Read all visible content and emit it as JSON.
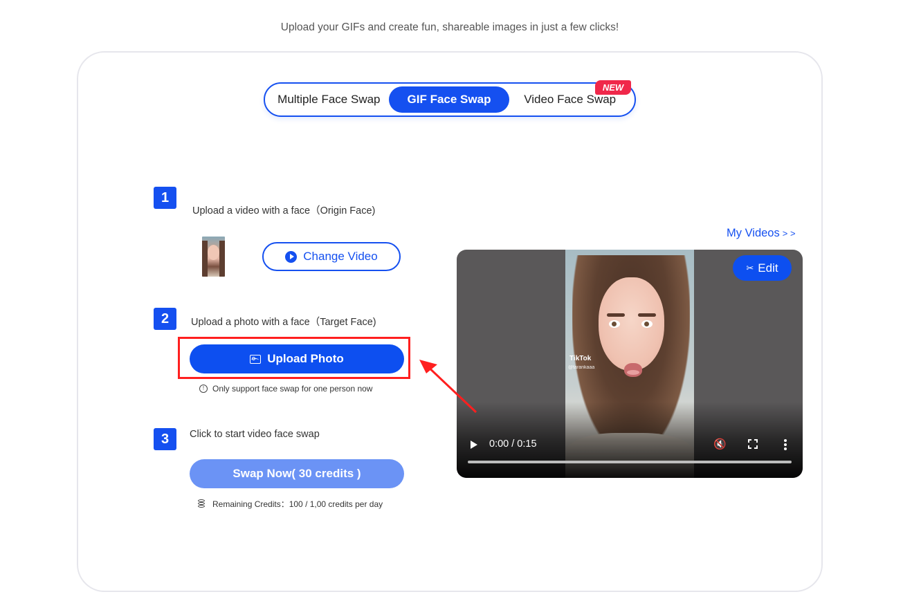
{
  "header": {
    "subtitle": "Upload your GIFs and create fun, shareable images in just a few clicks!"
  },
  "tabs": [
    {
      "label": "Multiple Face Swap",
      "active": false
    },
    {
      "label": "GIF Face Swap",
      "active": true
    },
    {
      "label": "Video Face Swap",
      "active": false,
      "badge": "NEW"
    }
  ],
  "steps": [
    {
      "number": "1",
      "text": "Upload a video with a face（Origin Face)",
      "button_label": "Change Video",
      "button_icon": "play-circle-icon"
    },
    {
      "number": "2",
      "text": "Upload a photo with a face（Target Face)",
      "button_label": "Upload Photo",
      "button_icon": "image-icon",
      "note": "Only support face swap for one person now",
      "note_icon": "info-icon"
    },
    {
      "number": "3",
      "text": "Click to start video face swap",
      "button_label": "Swap Now( 30 credits )",
      "credits_text": "Remaining Credits：100 / 1,00 credits per day",
      "credits_icon": "coins-icon"
    }
  ],
  "video_panel": {
    "my_videos_label": "My Videos",
    "my_videos_arrows": "> >",
    "edit_label": "Edit",
    "edit_icon": "scissors-icon",
    "time_display": "0:00 / 0:15",
    "progress": 0,
    "muted": true,
    "watermark_brand": "TikTok",
    "watermark_handle": "@tarankaaa"
  },
  "annotation": {
    "highlight_color": "#ff1f1f",
    "target": "Upload Photo"
  },
  "colors": {
    "primary": "#1550f0",
    "disabled": "#6b93f5",
    "badge": "#f0284a"
  }
}
